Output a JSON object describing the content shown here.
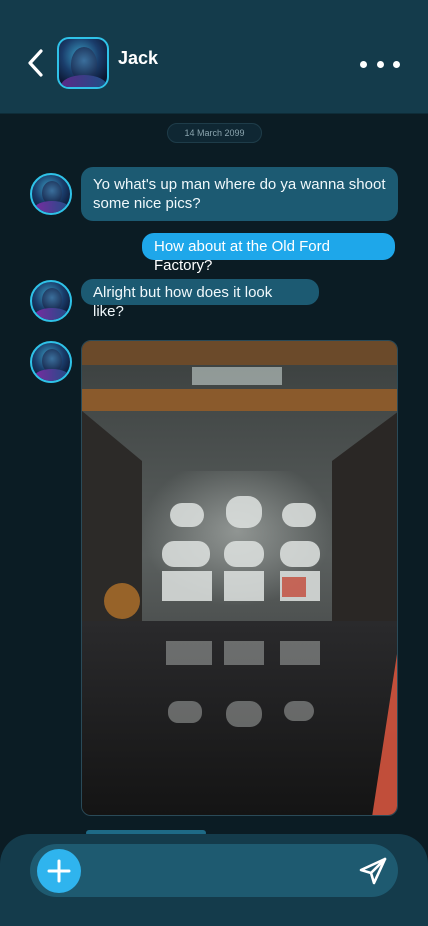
{
  "header": {
    "contact_name": "Jack",
    "back_icon": "chevron-left-icon",
    "more_icon": "more-horizontal-icon"
  },
  "chat": {
    "date_label": "14 March 2099",
    "messages": [
      {
        "from": "contact",
        "text": "Yo what's up man where do ya wanna shoot some nice pics?"
      },
      {
        "from": "me",
        "text": "How about at the Old Ford Factory?"
      },
      {
        "from": "contact",
        "text": "Alright but how does it look like?"
      },
      {
        "from": "contact",
        "type": "image"
      }
    ]
  },
  "composer": {
    "input_value": "",
    "input_placeholder": "",
    "add_icon": "plus-icon",
    "send_icon": "send-icon"
  },
  "colors": {
    "background": "#0b1c24",
    "header": "#143b4b",
    "received_bubble": "#1c5a72",
    "sent_bubble": "#1ea7ea",
    "accent": "#2fb4ee"
  }
}
